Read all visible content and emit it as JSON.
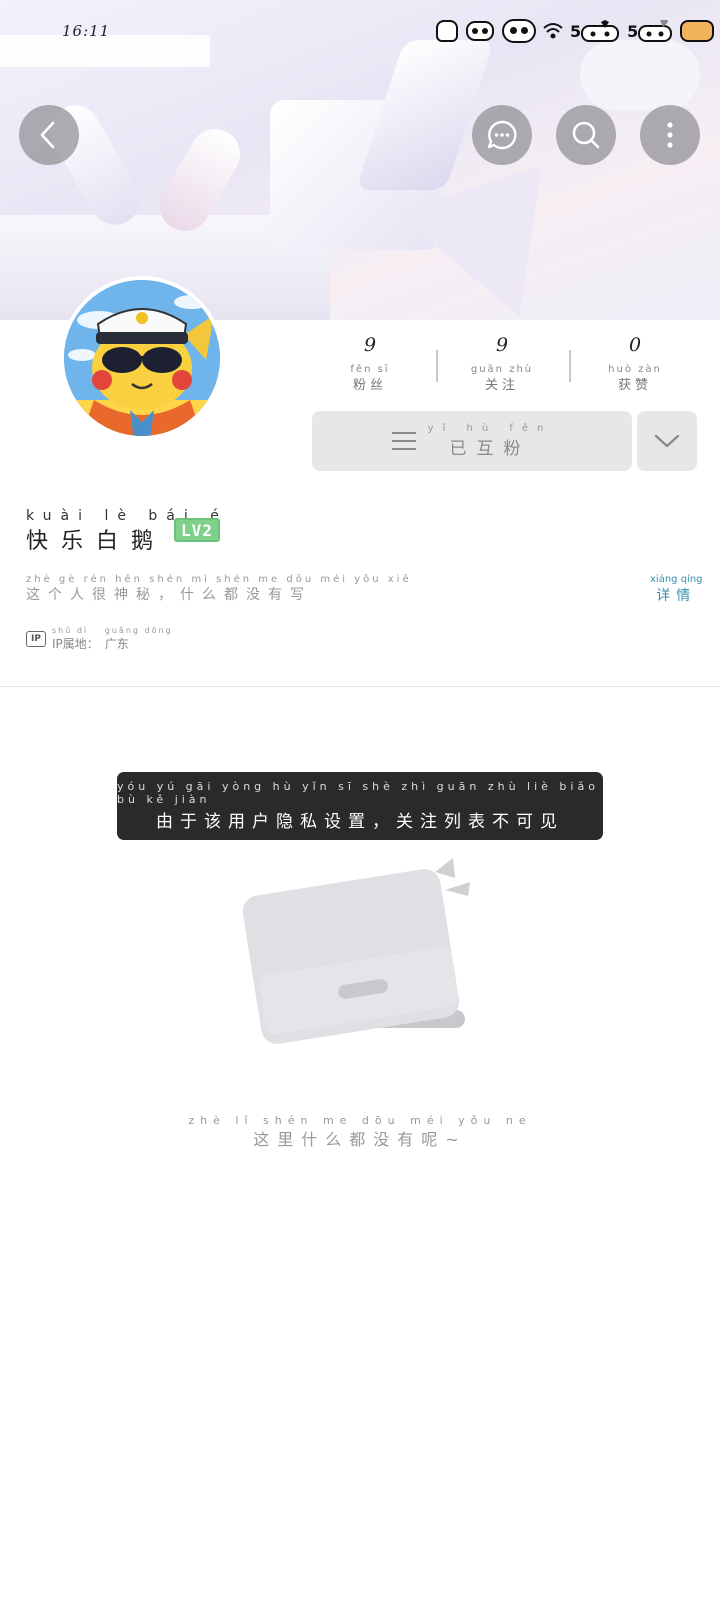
{
  "status_bar": {
    "time": "16:11",
    "signal_a": "5",
    "signal_b": "5",
    "icons": [
      "cat-icon",
      "data-saver-icon",
      "panda-icon",
      "wifi-icon",
      "signal-icon",
      "signal-icon",
      "battery-icon"
    ]
  },
  "header": {
    "back_icon": "chevron-left-icon",
    "chat_icon": "chat-bubble-icon",
    "search_icon": "search-icon",
    "more_icon": "more-vertical-icon"
  },
  "profile": {
    "stats": [
      {
        "num": "9",
        "pinyin": "fěn  sī",
        "label": "粉丝"
      },
      {
        "num": "9",
        "pinyin": "guān zhù",
        "label": "关注"
      },
      {
        "num": "0",
        "pinyin": "huò zàn",
        "label": "获赞"
      }
    ],
    "mutual_button": {
      "pinyin": "yǐ hù fěn",
      "label": "已互粉"
    },
    "name_pinyin": "kuài  lè  bái  é",
    "name": "快乐白鹅",
    "level": "LV2",
    "bio_pinyin": "zhè  gè  rén hěn shén mì     shén me dōu méi yǒu xiě",
    "bio": "这个人很神秘，什么都没有写",
    "detail_pinyin": "xiáng qíng",
    "detail": "详情",
    "ip_tag": "IP",
    "ip_prefix_pinyin": "shǔ dì",
    "ip_prefix": "IP属地：",
    "ip_location_pinyin": "guǎng dōng",
    "ip_location": "广东"
  },
  "toast": {
    "pinyin": "yóu  yú  gāi yòng hù  yǐn  sī  shè  zhì    guān zhù  liè  biǎo  bù  kě  jiàn",
    "text": "由于该用户隐私设置，关注列表不可见"
  },
  "empty_state": {
    "pinyin": "zhè  lǐ  shén me  dōu  méi  yǒu  ne",
    "text": "这里什么都没有呢~",
    "illustration": "empty-box-illustration"
  },
  "colors": {
    "link": "#3a8fb0",
    "level_badge": "#7fd08a",
    "toast_bg": "#2a2a2a",
    "button_bg": "#e7e7e7"
  }
}
